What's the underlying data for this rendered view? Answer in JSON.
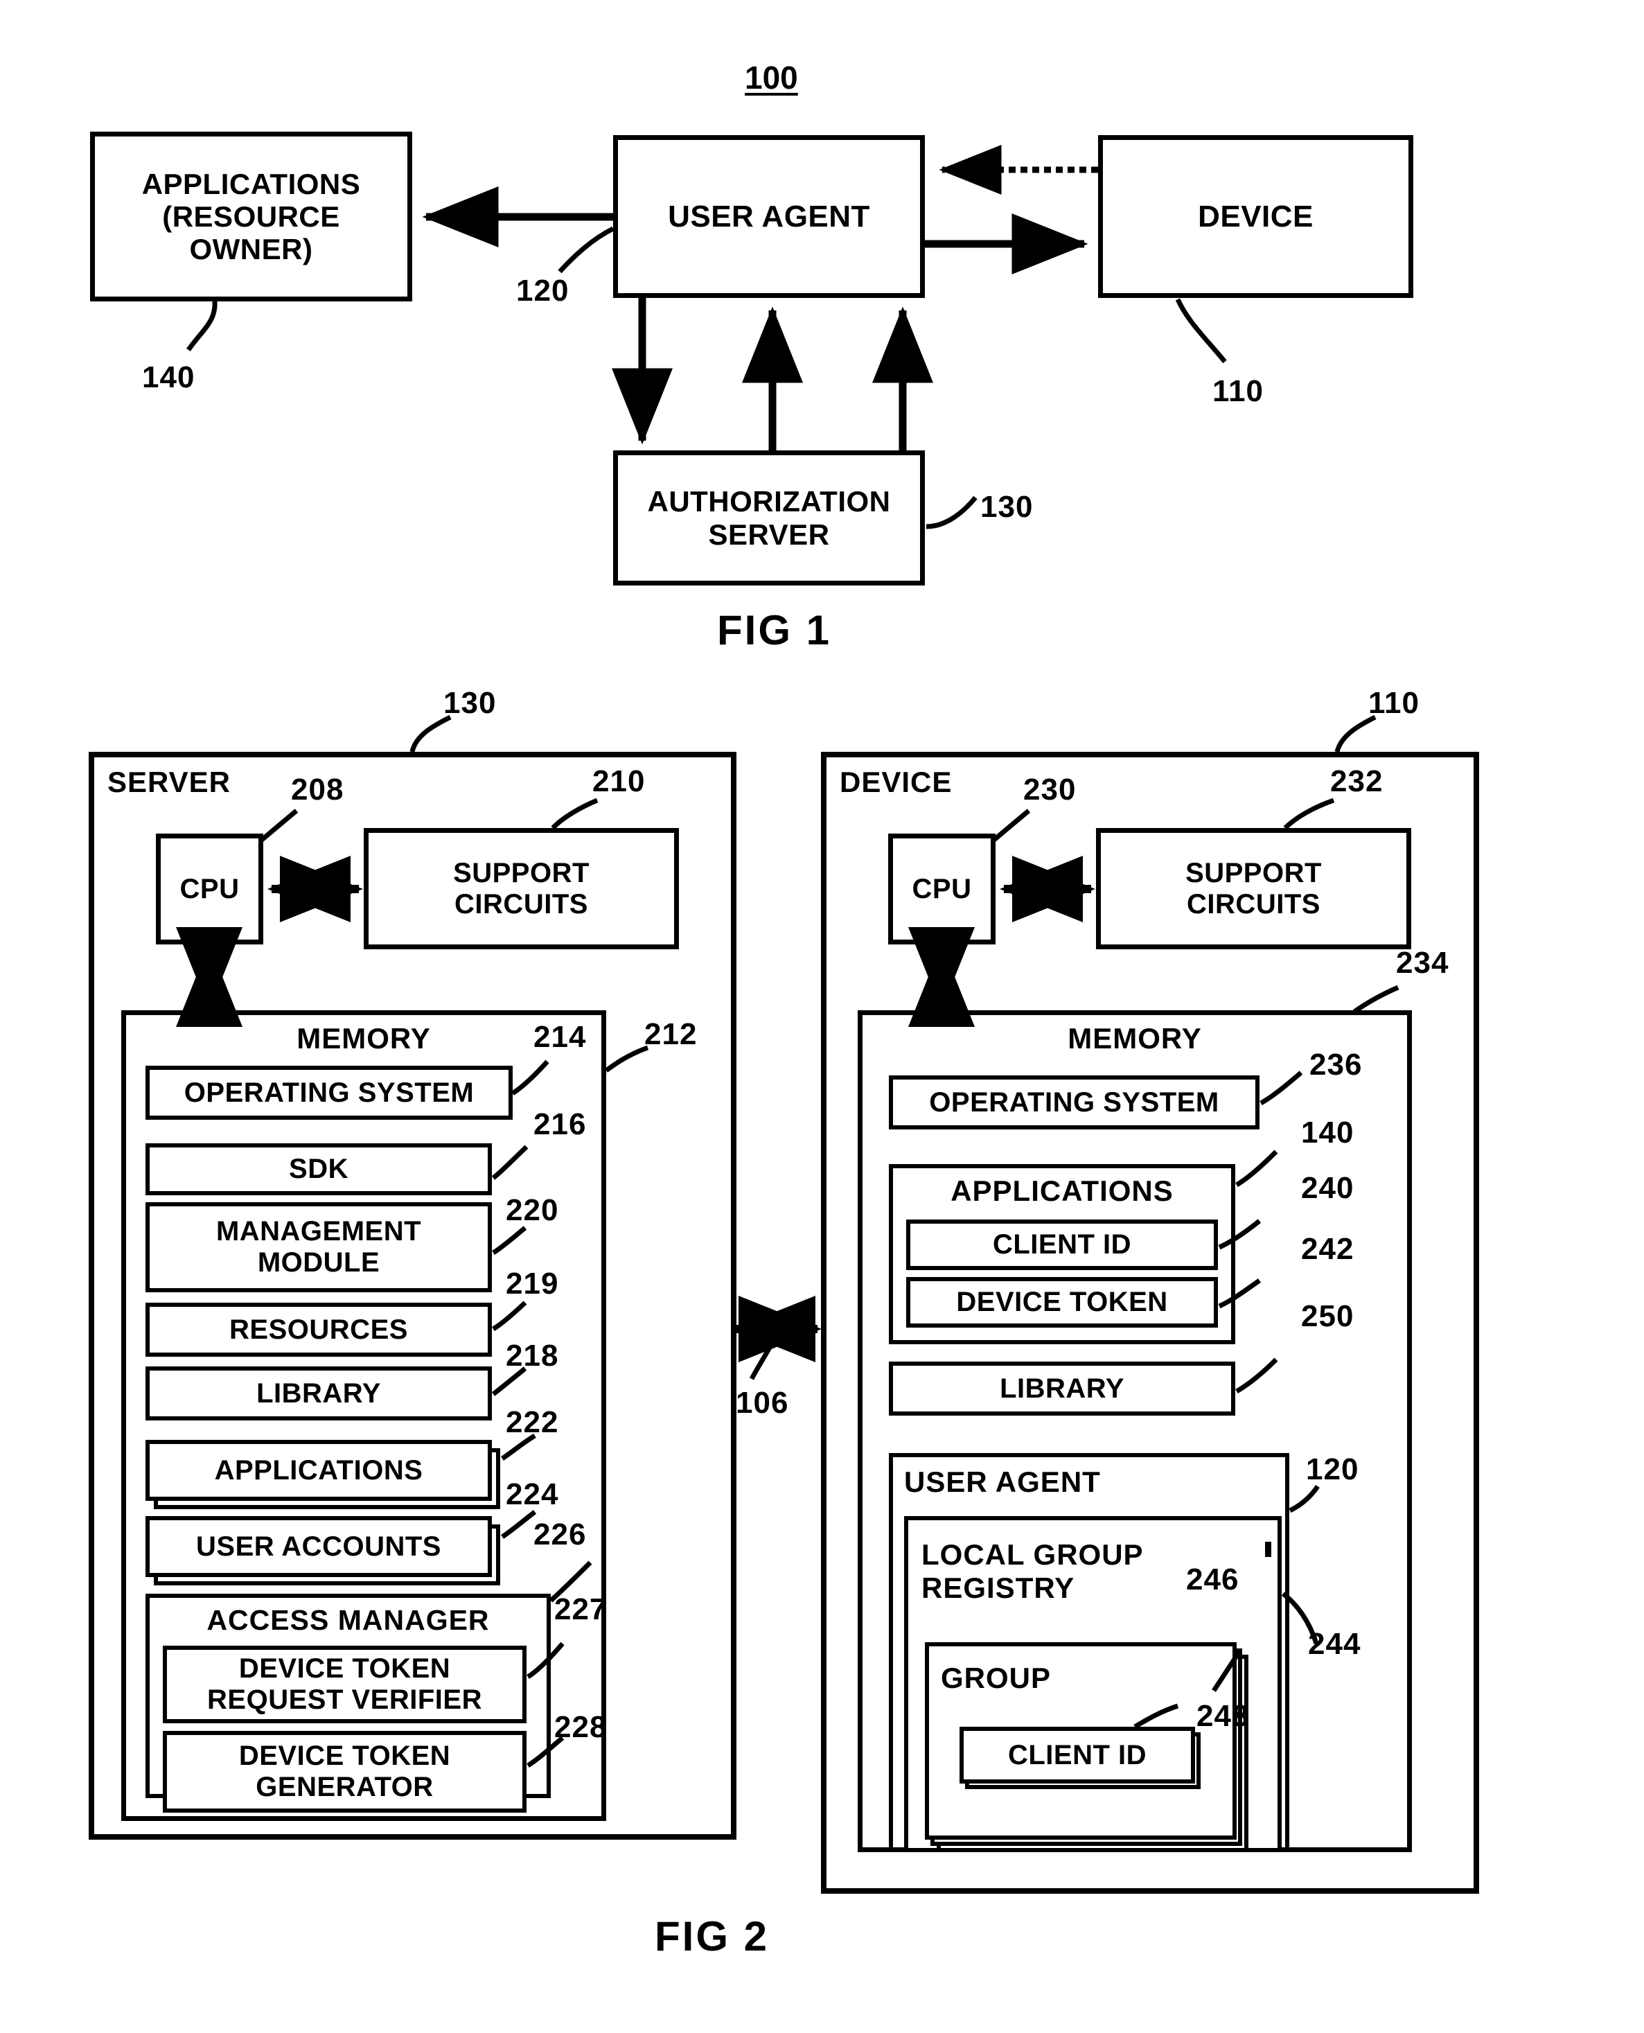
{
  "figure1": {
    "figure_number": "100",
    "caption": "FIG 1",
    "nodes": {
      "applications": {
        "label": "APPLICATIONS\n(RESOURCE\nOWNER)",
        "ref": "140"
      },
      "user_agent": {
        "label": "USER AGENT",
        "ref": "120"
      },
      "device": {
        "label": "DEVICE",
        "ref": "110"
      },
      "authorization_server": {
        "label": "AUTHORIZATION\nSERVER",
        "ref": "130"
      }
    }
  },
  "figure2": {
    "caption": "FIG 2",
    "link_ref": "106",
    "server": {
      "title": "SERVER",
      "ref": "130",
      "cpu": {
        "label": "CPU",
        "ref": "208"
      },
      "support_circuits": {
        "label": "SUPPORT\nCIRCUITS",
        "ref": "210"
      },
      "memory": {
        "label": "MEMORY",
        "ref": "212",
        "items": [
          {
            "label": "OPERATING SYSTEM",
            "ref": "214",
            "stacked": false
          },
          {
            "label": "SDK",
            "ref": "216",
            "stacked": false
          },
          {
            "label": "MANAGEMENT\nMODULE",
            "ref": "220",
            "stacked": false
          },
          {
            "label": "RESOURCES",
            "ref": "219",
            "stacked": false
          },
          {
            "label": "LIBRARY",
            "ref": "218",
            "stacked": false
          },
          {
            "label": "APPLICATIONS",
            "ref": "222",
            "stacked": true
          },
          {
            "label": "USER ACCOUNTS",
            "ref": "224",
            "stacked": true
          }
        ],
        "access_manager": {
          "label": "ACCESS MANAGER",
          "ref": "226",
          "children": [
            {
              "label": "DEVICE TOKEN\nREQUEST VERIFIER",
              "ref": "227"
            },
            {
              "label": "DEVICE TOKEN\nGENERATOR",
              "ref": "228"
            }
          ]
        }
      }
    },
    "device": {
      "title": "DEVICE",
      "ref": "110",
      "cpu": {
        "label": "CPU",
        "ref": "230"
      },
      "support_circuits": {
        "label": "SUPPORT\nCIRCUITS",
        "ref": "232"
      },
      "memory": {
        "label": "MEMORY",
        "ref": "234",
        "operating_system": {
          "label": "OPERATING SYSTEM",
          "ref": "236"
        },
        "applications": {
          "label": "APPLICATIONS",
          "ref": "140",
          "children": [
            {
              "label": "CLIENT ID",
              "ref": "240"
            },
            {
              "label": "DEVICE TOKEN",
              "ref": "242"
            }
          ]
        },
        "library": {
          "label": "LIBRARY",
          "ref": "250"
        },
        "user_agent": {
          "label": "USER AGENT",
          "ref": "120",
          "local_group_registry": {
            "label": "LOCAL GROUP\nREGISTRY",
            "ref": "244",
            "group": {
              "label": "GROUP",
              "ref": "246",
              "client_id": {
                "label": "CLIENT ID",
                "ref": "248"
              }
            }
          }
        }
      }
    }
  }
}
